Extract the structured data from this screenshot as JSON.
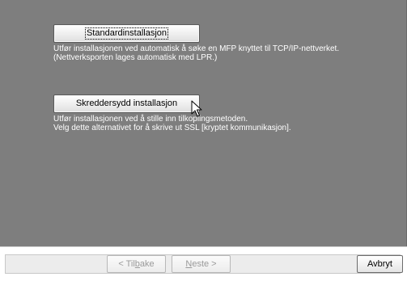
{
  "options": [
    {
      "button_label": "Standardinstallasjon",
      "description_lines": [
        "Utfør installasjonen ved automatisk å søke en MFP knyttet til TCP/IP-nettverket.",
        "(Nettverksporten lages automatisk med LPR.)"
      ]
    },
    {
      "button_label": "Skreddersydd installasjon",
      "description_lines": [
        "Utfør installasjonen ved å stille inn tilkoplingsmetoden.",
        "Velg dette alternativet for å skrive ut SSL [kryptet kommunikasjon]."
      ]
    }
  ],
  "footer": {
    "back": {
      "prefix": "< Til",
      "accel": "b",
      "suffix": "ake"
    },
    "next": {
      "prefix": "",
      "accel": "N",
      "suffix": "este >"
    },
    "cancel": "Avbryt"
  },
  "colors": {
    "panel_background": "#7e7e7e",
    "description_text": "#ffffff",
    "disabled_text": "#9a9a9a"
  },
  "icons": [
    "mouse-pointer-icon"
  ]
}
